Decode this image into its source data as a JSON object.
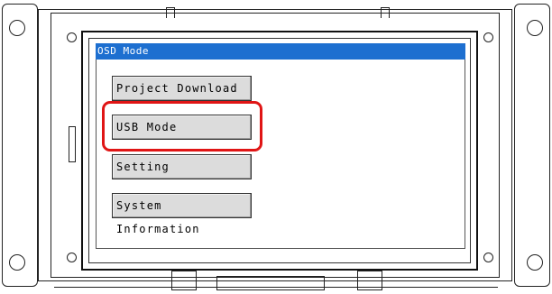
{
  "osd": {
    "title": "OSD Mode"
  },
  "menu": {
    "items": [
      {
        "label": "Project Download"
      },
      {
        "label": "USB Mode"
      },
      {
        "label": "Setting"
      },
      {
        "label": "System Information"
      }
    ],
    "highlighted": "USB Mode"
  },
  "colors": {
    "title_bar": "#1d6fd0",
    "highlight_outline": "#e01515",
    "button_face": "#dcdcdc"
  }
}
